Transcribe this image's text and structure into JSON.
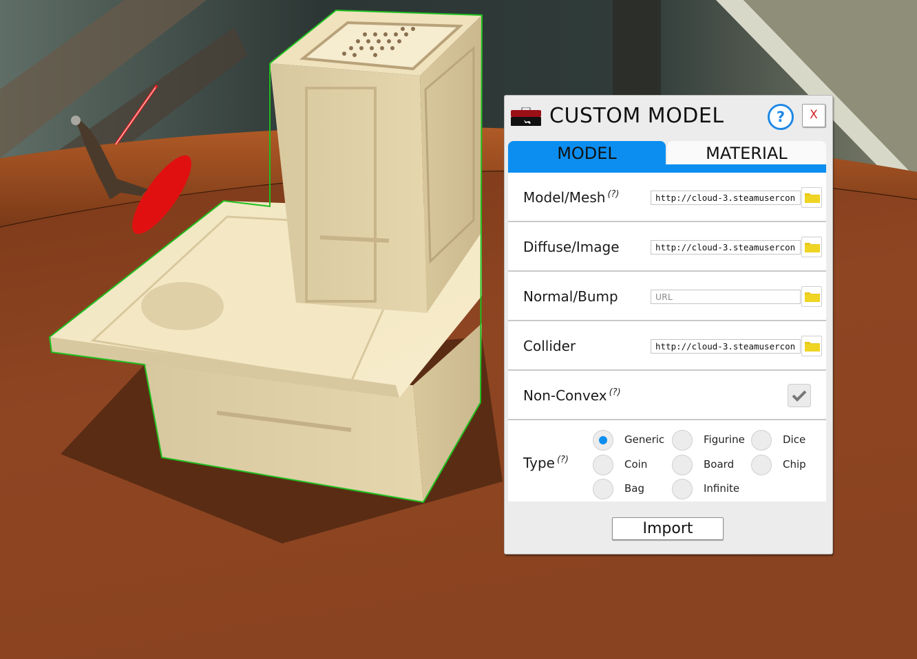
{
  "scene": {
    "description": "3D tabletop game view with a beige custom model selected (green outline), a figurine with a red lightsaber on a red base, wooden table",
    "colors": {
      "table_wood": "#8a4220",
      "table_wood_dark": "#6e3218",
      "backdrop": "#2f3d3b",
      "model_beige": "#e8d9b0",
      "selection_outline": "#1fbf1f",
      "figurine_base": "#e01010"
    }
  },
  "dialog": {
    "title": "CUSTOM MODEL",
    "icon": "toolbox-icon",
    "help_label": "?",
    "close_label": "X",
    "accent_color": "#0c8ef0",
    "tabs": [
      {
        "label": "MODEL",
        "active": true
      },
      {
        "label": "MATERIAL",
        "active": false
      }
    ],
    "fields": [
      {
        "label": "Model/Mesh",
        "hint": "(?)",
        "value": "http://cloud-3.steamusercon",
        "placeholder": "URL"
      },
      {
        "label": "Diffuse/Image",
        "hint": "",
        "value": "http://cloud-3.steamusercon",
        "placeholder": "URL"
      },
      {
        "label": "Normal/Bump",
        "hint": "",
        "value": "",
        "placeholder": "URL"
      },
      {
        "label": "Collider",
        "hint": "",
        "value": "http://cloud-3.steamusercon",
        "placeholder": "URL"
      }
    ],
    "non_convex": {
      "label": "Non-Convex",
      "hint": "(?)",
      "checked": true
    },
    "type": {
      "label": "Type",
      "hint": "(?)",
      "selected": "Generic",
      "options": [
        "Generic",
        "Figurine",
        "Dice",
        "Coin",
        "Board",
        "Chip",
        "Bag",
        "Infinite"
      ]
    },
    "import_label": "Import"
  }
}
